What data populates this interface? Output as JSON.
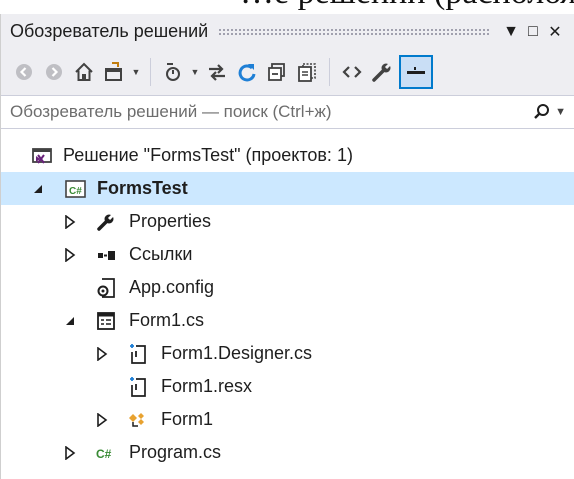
{
  "background_caption": "…е решений (расположено справа",
  "window": {
    "title": "Обозреватель решений",
    "buttons": [
      "▼",
      "□",
      "✕"
    ]
  },
  "toolbar": {
    "icons": [
      "back-icon",
      "forward-icon",
      "home-icon",
      "switch-views-icon",
      "pending-changes-icon",
      "sync-icon",
      "refresh-icon",
      "collapse-all-icon",
      "show-all-files-icon",
      "view-code-icon",
      "properties-icon",
      "preview-icon"
    ],
    "accent": "#007acc"
  },
  "search": {
    "placeholder": "Обозреватель решений — поиск (Ctrl+ж)",
    "icon": "search-icon"
  },
  "tree": [
    {
      "label": "Решение \"FormsTest\"  (проектов: 1)",
      "icon": "solution-icon",
      "level": 0,
      "arrow": "none"
    },
    {
      "label": "FormsTest",
      "icon": "csharp-project-icon",
      "level": 0,
      "arrow": "expanded",
      "selected": true
    },
    {
      "label": "Properties",
      "icon": "wrench-icon",
      "level": 1,
      "arrow": "collapsed"
    },
    {
      "label": "Ссылки",
      "icon": "references-icon",
      "level": 1,
      "arrow": "collapsed"
    },
    {
      "label": "App.config",
      "icon": "config-file-icon",
      "level": 1,
      "arrow": "none"
    },
    {
      "label": "Form1.cs",
      "icon": "form-icon",
      "level": 1,
      "arrow": "expanded"
    },
    {
      "label": "Form1.Designer.cs",
      "icon": "cs-file-icon",
      "level": 2,
      "arrow": "collapsed"
    },
    {
      "label": "Form1.resx",
      "icon": "cs-file-icon",
      "level": 2,
      "arrow": "none"
    },
    {
      "label": "Form1",
      "icon": "class-icon",
      "level": 2,
      "arrow": "collapsed"
    },
    {
      "label": "Program.cs",
      "icon": "csharp-file-icon",
      "level": 1,
      "arrow": "collapsed"
    }
  ]
}
